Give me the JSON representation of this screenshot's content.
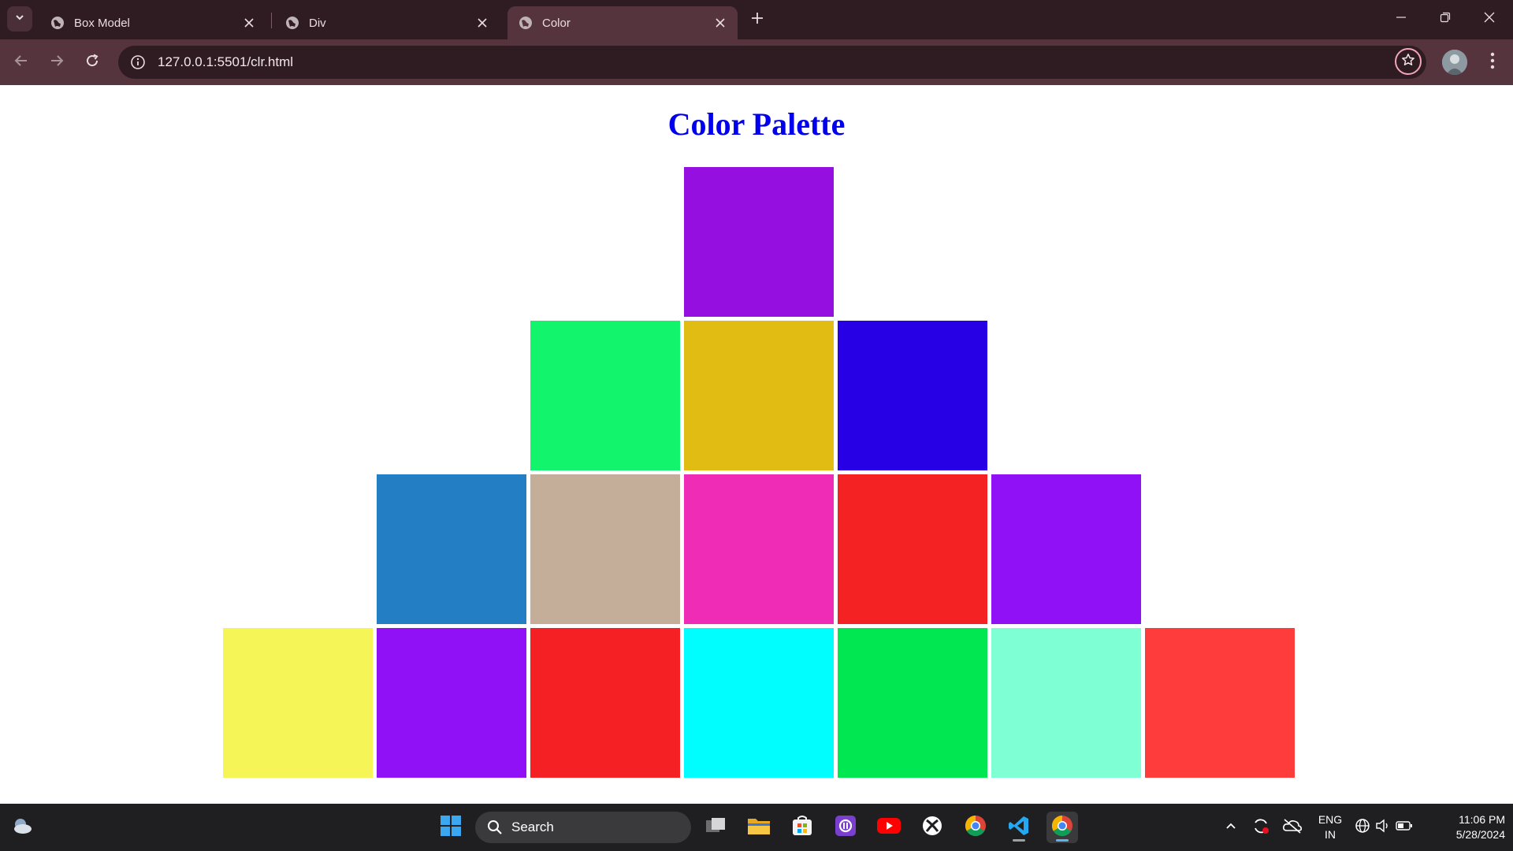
{
  "browser": {
    "tabs": [
      {
        "label": "Box Model",
        "active": false
      },
      {
        "label": "Div",
        "active": false
      },
      {
        "label": "Color",
        "active": true
      }
    ],
    "url": "127.0.0.1:5501/clr.html"
  },
  "page": {
    "heading": "Color Palette",
    "rows": [
      [
        "#9510e0"
      ],
      [
        "#12f46c",
        "#e1bd13",
        "#2700e6"
      ],
      [
        "#237ec3",
        "#c4ae9a",
        "#ee2cb5",
        "#f52223",
        "#9111f6"
      ],
      [
        "#f6f557",
        "#9111f6",
        "#f52023",
        "#00feff",
        "#01e752",
        "#7fffd4",
        "#fe3c3b"
      ]
    ]
  },
  "taskbar": {
    "search_label": "Search",
    "language": "ENG",
    "region": "IN",
    "time": "11:06 PM",
    "date": "5/28/2024"
  },
  "colors": {
    "tabstrip_bg": "#2f1b22",
    "toolbar_bg": "#55343e",
    "heading": "#0000ee",
    "taskbar_bg": "#1f1f22"
  }
}
